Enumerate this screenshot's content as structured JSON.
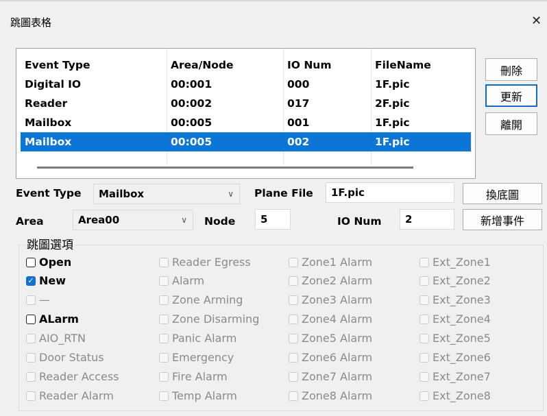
{
  "window": {
    "title": "跳圖表格",
    "close_glyph": "✕"
  },
  "table": {
    "headers": [
      "Event Type",
      "Area/Node",
      "IO Num",
      "FileName"
    ],
    "rows": [
      [
        "Digital IO",
        "00:001",
        "000",
        "1F.pic"
      ],
      [
        "Reader",
        "00:002",
        "017",
        "2F.pic"
      ],
      [
        "Mailbox",
        "00:005",
        "001",
        "1F.pic"
      ],
      [
        "Mailbox",
        "00:005",
        "002",
        "1F.pic"
      ]
    ],
    "selected_row": 3
  },
  "buttons": {
    "delete": "刪除",
    "update": "更新",
    "leave": "離開",
    "change_bg": "換底圖",
    "add_event": "新增事件"
  },
  "form": {
    "event_type_label": "Event Type",
    "event_type_value": "Mailbox",
    "plane_file_label": "Plane File",
    "plane_file_value": "1F.pic",
    "area_label": "Area",
    "area_value": "Area00",
    "node_label": "Node",
    "node_value": "5",
    "io_num_label": "IO Num",
    "io_num_value": "2"
  },
  "options": {
    "group_label": "跳圖選項",
    "columns": [
      [
        {
          "label": "Open",
          "checked": false,
          "enabled": true
        },
        {
          "label": "New",
          "checked": true,
          "enabled": true
        },
        {
          "label": "—",
          "checked": false,
          "enabled": false
        },
        {
          "label": "ALarm",
          "checked": false,
          "enabled": true
        },
        {
          "label": "AIO_RTN",
          "checked": false,
          "enabled": false
        },
        {
          "label": "Door Status",
          "checked": false,
          "enabled": false
        },
        {
          "label": "Reader Access",
          "checked": false,
          "enabled": false
        },
        {
          "label": "Reader Alarm",
          "checked": false,
          "enabled": false
        }
      ],
      [
        {
          "label": "Reader Egress",
          "checked": false,
          "enabled": false
        },
        {
          "label": "Alarm",
          "checked": false,
          "enabled": false
        },
        {
          "label": "Zone Arming",
          "checked": false,
          "enabled": false
        },
        {
          "label": "Zone Disarming",
          "checked": false,
          "enabled": false
        },
        {
          "label": "Panic Alarm",
          "checked": false,
          "enabled": false
        },
        {
          "label": "Emergency",
          "checked": false,
          "enabled": false
        },
        {
          "label": "Fire Alarm",
          "checked": false,
          "enabled": false
        },
        {
          "label": "Temp Alarm",
          "checked": false,
          "enabled": false
        }
      ],
      [
        {
          "label": "Zone1 Alarm",
          "checked": false,
          "enabled": false
        },
        {
          "label": "Zone2 Alarm",
          "checked": false,
          "enabled": false
        },
        {
          "label": "Zone3 Alarm",
          "checked": false,
          "enabled": false
        },
        {
          "label": "Zone4 Alarm",
          "checked": false,
          "enabled": false
        },
        {
          "label": "Zone5 Alarm",
          "checked": false,
          "enabled": false
        },
        {
          "label": "Zone6 Alarm",
          "checked": false,
          "enabled": false
        },
        {
          "label": "Zone7 Alarm",
          "checked": false,
          "enabled": false
        },
        {
          "label": "Zone8 Alarm",
          "checked": false,
          "enabled": false
        }
      ],
      [
        {
          "label": "Ext_Zone1",
          "checked": false,
          "enabled": false
        },
        {
          "label": "Ext_Zone2",
          "checked": false,
          "enabled": false
        },
        {
          "label": "Ext_Zone3",
          "checked": false,
          "enabled": false
        },
        {
          "label": "Ext_Zone4",
          "checked": false,
          "enabled": false
        },
        {
          "label": "Ext_Zone5",
          "checked": false,
          "enabled": false
        },
        {
          "label": "Ext_Zone6",
          "checked": false,
          "enabled": false
        },
        {
          "label": "Ext_Zone7",
          "checked": false,
          "enabled": false
        },
        {
          "label": "Ext_Zone8",
          "checked": false,
          "enabled": false
        }
      ]
    ]
  },
  "colors": {
    "selection": "#0c76d6",
    "check_accent": "#1470c9",
    "default_button_border": "#0f6cbd"
  }
}
